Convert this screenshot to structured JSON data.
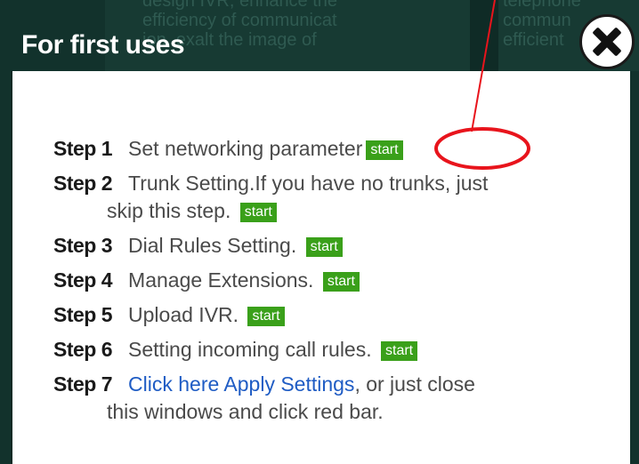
{
  "background": {
    "col1": [
      "design IVR, enhance the",
      "efficiency of communicat",
      "ion, exalt the image of"
    ],
    "col2": [
      "telephone",
      "commun",
      "efficient"
    ]
  },
  "dialog": {
    "title": "For first uses",
    "close_icon": "close-icon"
  },
  "steps": [
    {
      "label": "Step 1",
      "text": "Set networking parameter",
      "start": "start"
    },
    {
      "label": "Step 2",
      "text": "Trunk Setting.If you have no trunks, just",
      "text2": "skip this step.",
      "start": "start"
    },
    {
      "label": "Step 3",
      "text": "Dial Rules Setting.",
      "start": "start"
    },
    {
      "label": "Step 4",
      "text": "Manage Extensions.",
      "start": "start"
    },
    {
      "label": "Step 5",
      "text": "Upload IVR.",
      "start": "start"
    },
    {
      "label": "Step 6",
      "text": "Setting incoming call rules.",
      "start": "start"
    },
    {
      "label": "Step 7",
      "link": "Click here Apply Settings",
      "text": ", or just close",
      "text2": "this windows and click red bar."
    }
  ],
  "colors": {
    "header_bg": "#12322c",
    "start_bg": "#3aa01a",
    "link": "#1f5cc4",
    "annotation": "#e8141c"
  }
}
